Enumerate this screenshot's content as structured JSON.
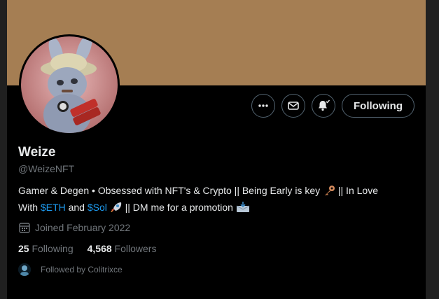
{
  "colors": {
    "banner": "#a57e53",
    "background": "#000000",
    "text_primary": "#e7e9ea",
    "text_secondary": "#71767b",
    "link": "#1d9bf0",
    "button_border": "#536471"
  },
  "actions": {
    "more_icon": "more-horizontal-icon",
    "message_icon": "envelope-icon",
    "notify_icon": "bell-check-icon",
    "following_label": "Following"
  },
  "profile": {
    "name": "Weize",
    "handle": "@WeizeNFT",
    "bio": {
      "line1_text": "Gamer & Degen • Obsessed with NFT's & Crypto || Being Early is key",
      "line1_after": " || In Love",
      "line2_with": "With ",
      "cashtag_eth": "$ETH",
      "and": " and ",
      "cashtag_sol": "$Sol",
      "line2_after": " || DM me for a promotion"
    },
    "joined": "Joined February 2022",
    "following_count": "25",
    "following_label": "Following",
    "followers_count": "4,568",
    "followers_label": "Followers",
    "followed_by": "Followed by Colitrixce"
  }
}
